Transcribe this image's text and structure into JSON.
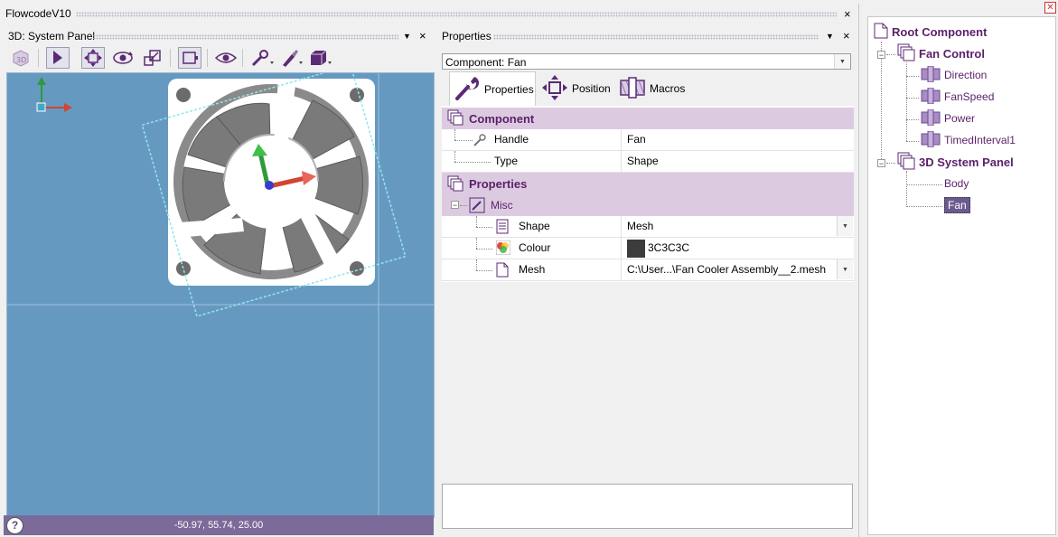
{
  "app": {
    "title": "FlowcodeV10"
  },
  "system_panel": {
    "title": "3D: System Panel",
    "status_coords": "-50.97, 55.74, 25.00",
    "help_label": "?"
  },
  "properties": {
    "title": "Properties",
    "component_select": "Component: Fan",
    "tabs": [
      {
        "label": "Properties",
        "active": true
      },
      {
        "label": "Position",
        "active": false
      },
      {
        "label": "Macros",
        "active": false
      }
    ],
    "sections": {
      "component": "Component",
      "properties": "Properties",
      "misc": "Misc"
    },
    "rows": {
      "handle": {
        "key": "Handle",
        "value": "Fan"
      },
      "type": {
        "key": "Type",
        "value": "Shape"
      },
      "shape": {
        "key": "Shape",
        "value": "Mesh"
      },
      "colour": {
        "key": "Colour",
        "value": "3C3C3C",
        "swatch": "#3c3c3c"
      },
      "mesh": {
        "key": "Mesh",
        "value": "C:\\User...\\Fan Cooler Assembly__2.mesh"
      }
    },
    "expander_minus": "⊟"
  },
  "tree": {
    "root": "Root Component",
    "fan_control": "Fan Control",
    "fan_control_children": [
      "Direction",
      "FanSpeed",
      "Power",
      "TimedInterval1"
    ],
    "system_panel": "3D System Panel",
    "system_panel_children": [
      "Body",
      "Fan"
    ],
    "expander_minus": "−"
  },
  "icons": {
    "close": "×",
    "pin": "▼",
    "dropdown": "▼",
    "tree_close": "✕"
  },
  "colors": {
    "viewport": "#6699c0",
    "accent_purple": "#7b6a9a",
    "tree_text": "#5b1f6a",
    "category_bg": "#dccbe0"
  }
}
